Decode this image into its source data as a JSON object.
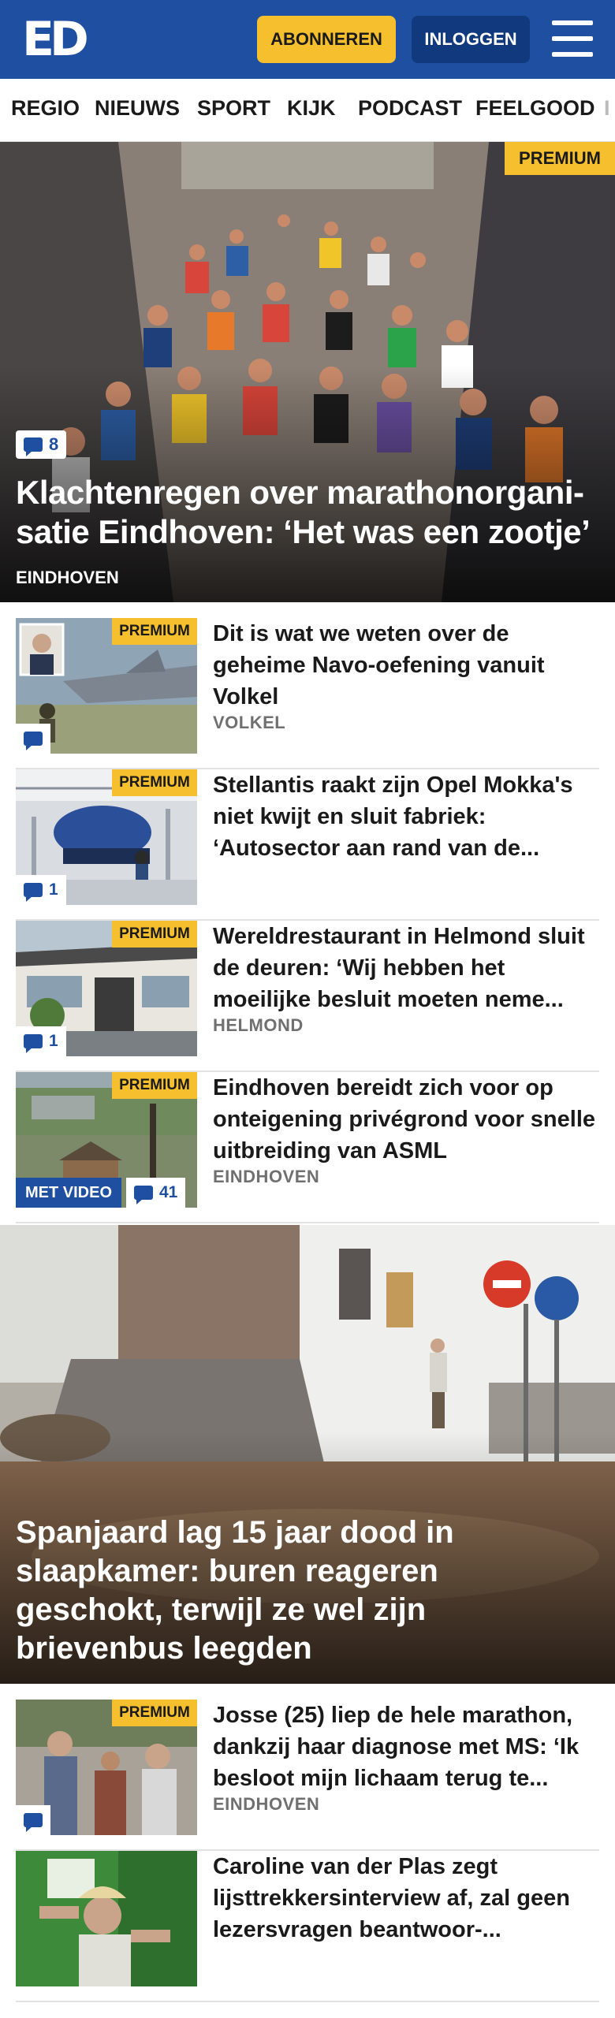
{
  "header": {
    "logo": "ED",
    "subscribe_label": "ABONNEREN",
    "login_label": "INLOGGEN",
    "colors": {
      "brand": "#1e4fa0",
      "accent": "#f5bf2d"
    }
  },
  "nav": {
    "items": [
      "REGIO",
      "NIEUWS",
      "SPORT",
      "KIJK",
      "PODCAST",
      "FEELGOOD",
      "I"
    ]
  },
  "hero": {
    "premium_label": "PREMIUM",
    "comments": "8",
    "title": "Klachtenregen over marathonorgani-satie Eindhoven: ‘Het was een zootje’",
    "category": "EINDHOVEN"
  },
  "articles": [
    {
      "premium_label": "PREMIUM",
      "comments": "",
      "title": "Dit is wat we weten over de geheime Navo-oefening vanuit Volkel",
      "category": "VOLKEL"
    },
    {
      "premium_label": "PREMIUM",
      "comments": "1",
      "title": "Stellantis raakt zijn Opel Mokka's niet kwijt en sluit fabriek: ‘Autosector aan rand van de...",
      "category": ""
    },
    {
      "premium_label": "PREMIUM",
      "comments": "1",
      "title": "Wereldrestaurant in Helmond sluit de deuren: ‘Wij hebben het moeilijke besluit moeten neme...",
      "category": "HELMOND"
    },
    {
      "premium_label": "PREMIUM",
      "video_label": "MET VIDEO",
      "comments": "41",
      "title": "Eindhoven bereidt zich voor op onteigening privégrond voor snelle uitbreiding van ASML",
      "category": "EINDHOVEN"
    }
  ],
  "big_story": {
    "title": "Spanjaard lag 15 jaar dood in slaapkamer: buren reageren geschokt, terwijl ze wel zijn brievenbus leegden"
  },
  "articles_lower": [
    {
      "premium_label": "PREMIUM",
      "comments": "",
      "title": "Josse (25) liep de hele marathon, dankzij haar diagnose met MS: ‘Ik besloot mijn lichaam terug te...",
      "category": "EINDHOVEN"
    },
    {
      "title": "Caroline van der Plas zegt lijsttrekkersinterview af, zal geen lezersvragen beantwoor-..."
    }
  ]
}
